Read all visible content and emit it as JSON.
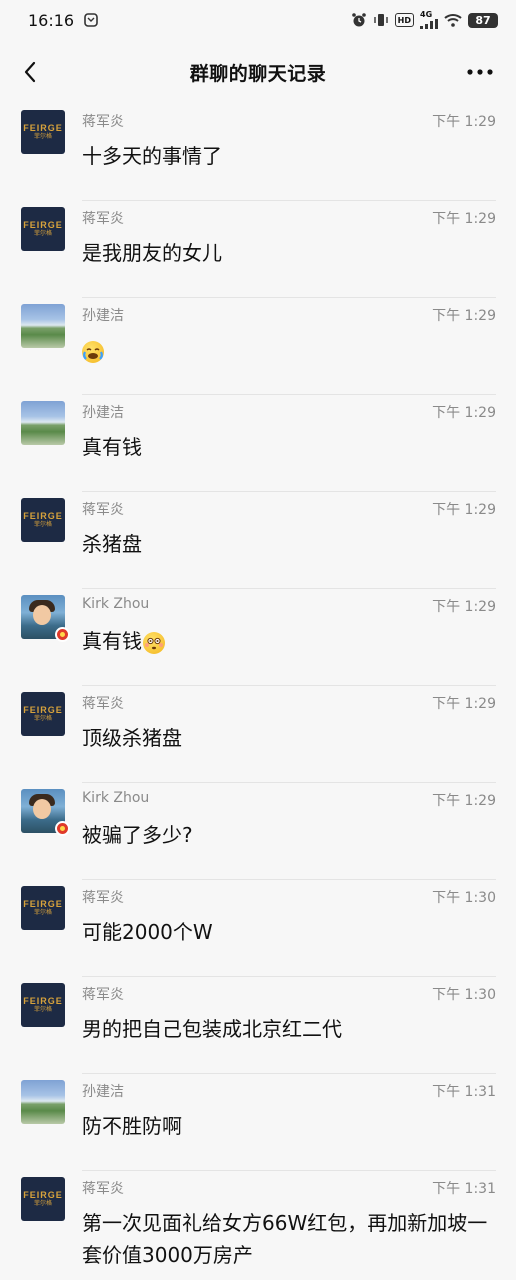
{
  "status_bar": {
    "time": "16:16",
    "network": "4G",
    "hd": "HD",
    "battery": "87"
  },
  "nav": {
    "title": "群聊的聊天记录",
    "back_icon": "chevron-left-icon",
    "more_icon": "more-dots-icon"
  },
  "messages": [
    {
      "sender": "蒋军炎",
      "time": "下午 1:29",
      "text": "十多天的事情了",
      "avatar": "feirge"
    },
    {
      "sender": "蒋军炎",
      "time": "下午 1:29",
      "text": "是我朋友的女儿",
      "avatar": "feirge"
    },
    {
      "sender": "孙建洁",
      "time": "下午 1:29",
      "text": "",
      "emoji": "crying-face-emoji",
      "avatar": "landscape"
    },
    {
      "sender": "孙建洁",
      "time": "下午 1:29",
      "text": "真有钱",
      "avatar": "landscape"
    },
    {
      "sender": "蒋军炎",
      "time": "下午 1:29",
      "text": "杀猪盘",
      "avatar": "feirge"
    },
    {
      "sender": "Kirk Zhou",
      "time": "下午 1:29",
      "text": "真有钱",
      "emoji": "flushed-face-emoji",
      "avatar": "kirk"
    },
    {
      "sender": "蒋军炎",
      "time": "下午 1:29",
      "text": "顶级杀猪盘",
      "avatar": "feirge"
    },
    {
      "sender": "Kirk Zhou",
      "time": "下午 1:29",
      "text": "被骗了多少?",
      "avatar": "kirk"
    },
    {
      "sender": "蒋军炎",
      "time": "下午 1:30",
      "text": "可能2000个W",
      "avatar": "feirge"
    },
    {
      "sender": "蒋军炎",
      "time": "下午 1:30",
      "text": "男的把自己包装成北京红二代",
      "avatar": "feirge"
    },
    {
      "sender": "孙建洁",
      "time": "下午 1:31",
      "text": "防不胜防啊",
      "avatar": "landscape"
    },
    {
      "sender": "蒋军炎",
      "time": "下午 1:31",
      "text": "第一次见面礼给女方66W红包，再加新加坡一套价值3000万房产",
      "avatar": "feirge"
    }
  ],
  "avatar_logo": {
    "line1": "FEIRGE",
    "line2": "菲尔格"
  },
  "colors": {
    "background": "#f7f7f7",
    "meta_text": "#8a8a8a",
    "logo_gold": "#d7a23c",
    "logo_bg": "#1d2a44"
  }
}
